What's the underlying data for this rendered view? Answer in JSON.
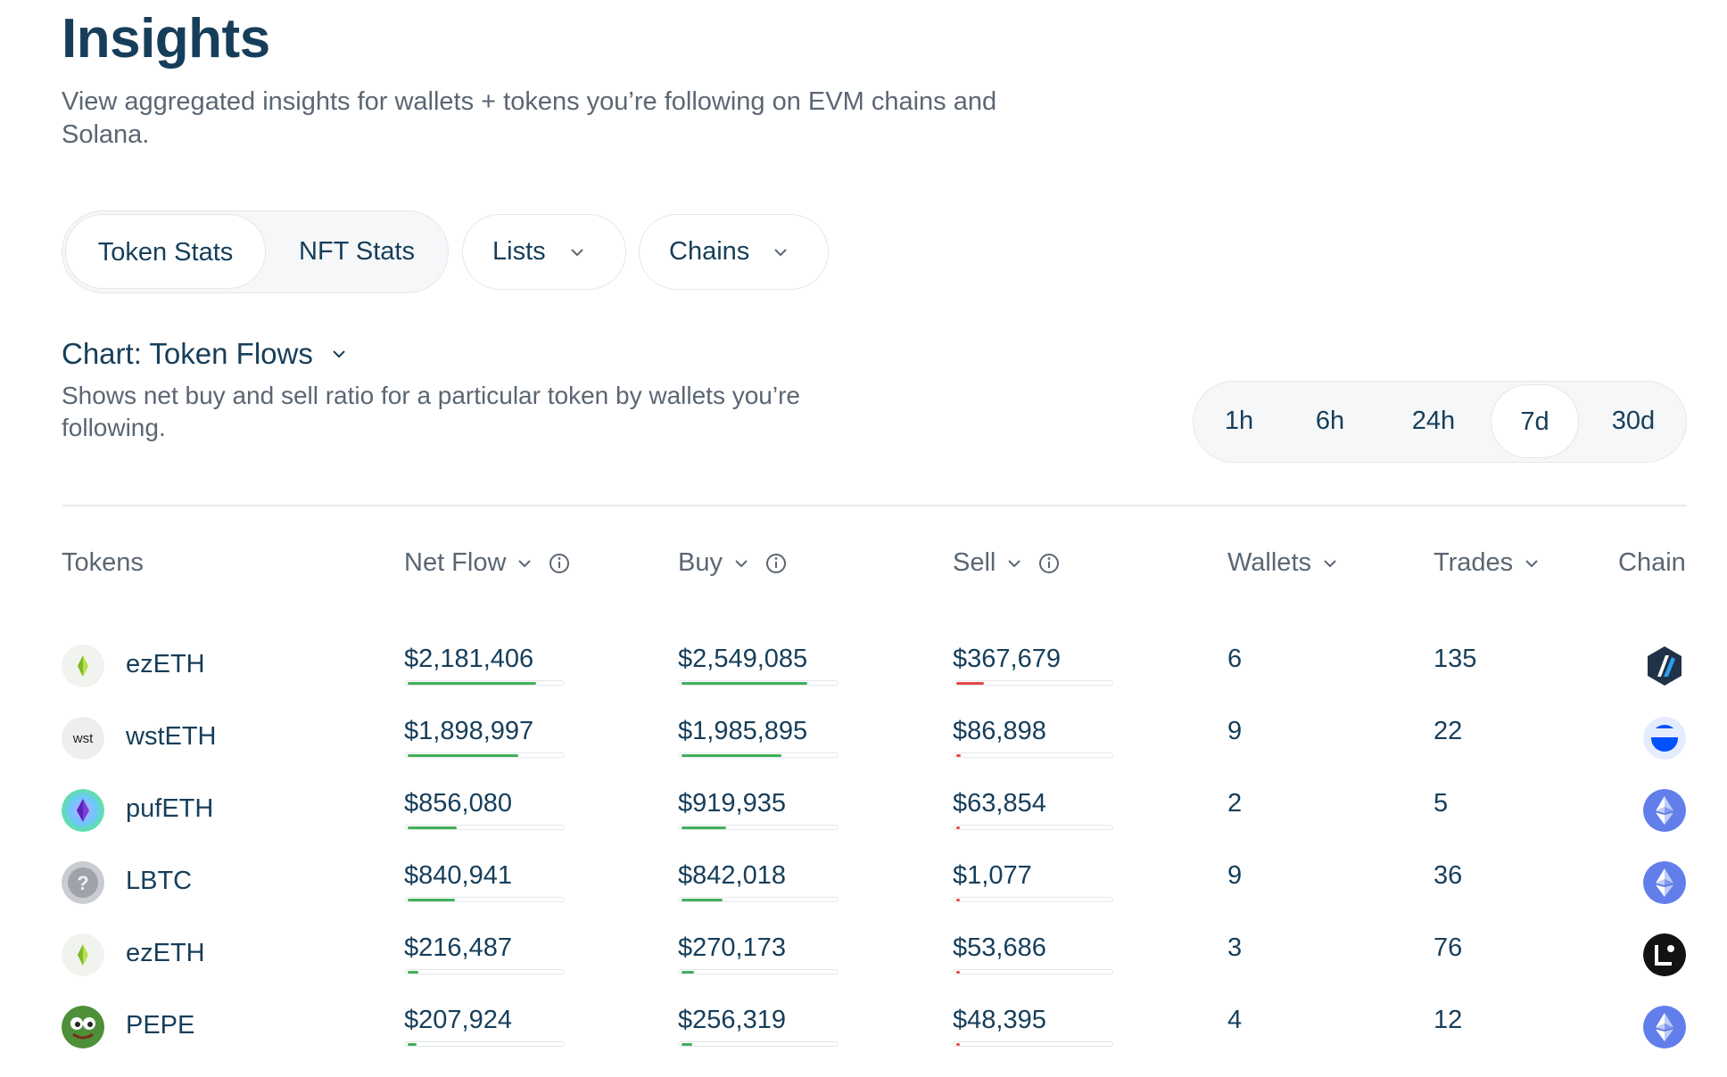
{
  "page": {
    "title": "Insights",
    "subtitle": "View aggregated insights for wallets + tokens you’re following on EVM chains and Solana."
  },
  "tabs": {
    "token_stats": "Token Stats",
    "nft_stats": "NFT Stats",
    "lists": "Lists",
    "chains": "Chains"
  },
  "chart": {
    "title": "Chart: Token Flows",
    "description": "Shows net buy and sell ratio for a particular token by wallets you’re following."
  },
  "ranges": [
    "1h",
    "6h",
    "24h",
    "7d",
    "30d"
  ],
  "active_range": "7d",
  "columns": {
    "tokens": "Tokens",
    "net_flow": "Net Flow",
    "buy": "Buy",
    "sell": "Sell",
    "wallets": "Wallets",
    "trades": "Trades",
    "chain": "Chain"
  },
  "colors": {
    "buy_bar": "#3fb15a",
    "sell_bar": "#e5484d",
    "text": "#163e5a",
    "muted": "#5b6673"
  },
  "rows": [
    {
      "token": "ezETH",
      "icon": "ezeth-icon",
      "net_flow": "$2,181,406",
      "net_ratio": 0.84,
      "buy": "$2,549,085",
      "buy_ratio": 0.82,
      "sell": "$367,679",
      "sell_ratio": 0.18,
      "wallets": "6",
      "trades": "135",
      "chain": "arbitrum-icon"
    },
    {
      "token": "wstETH",
      "icon": "wsteth-icon",
      "icon_text": "wst",
      "net_flow": "$1,898,997",
      "net_ratio": 0.72,
      "buy": "$1,985,895",
      "buy_ratio": 0.65,
      "sell": "$86,898",
      "sell_ratio": 0.03,
      "wallets": "9",
      "trades": "22",
      "chain": "base-icon"
    },
    {
      "token": "pufETH",
      "icon": "pufeth-icon",
      "net_flow": "$856,080",
      "net_ratio": 0.32,
      "buy": "$919,935",
      "buy_ratio": 0.29,
      "sell": "$63,854",
      "sell_ratio": 0.02,
      "wallets": "2",
      "trades": "5",
      "chain": "ethereum-icon"
    },
    {
      "token": "LBTC",
      "icon": "unknown-token-icon",
      "net_flow": "$840,941",
      "net_ratio": 0.31,
      "buy": "$842,018",
      "buy_ratio": 0.27,
      "sell": "$1,077",
      "sell_ratio": 0.01,
      "wallets": "9",
      "trades": "36",
      "chain": "ethereum-icon"
    },
    {
      "token": "ezETH",
      "icon": "ezeth-icon",
      "net_flow": "$216,487",
      "net_ratio": 0.07,
      "buy": "$270,173",
      "buy_ratio": 0.08,
      "sell": "$53,686",
      "sell_ratio": 0.02,
      "wallets": "3",
      "trades": "76",
      "chain": "linea-icon"
    },
    {
      "token": "PEPE",
      "icon": "pepe-icon",
      "net_flow": "$207,924",
      "net_ratio": 0.06,
      "buy": "$256,319",
      "buy_ratio": 0.07,
      "sell": "$48,395",
      "sell_ratio": 0.02,
      "wallets": "4",
      "trades": "12",
      "chain": "ethereum-icon"
    }
  ]
}
